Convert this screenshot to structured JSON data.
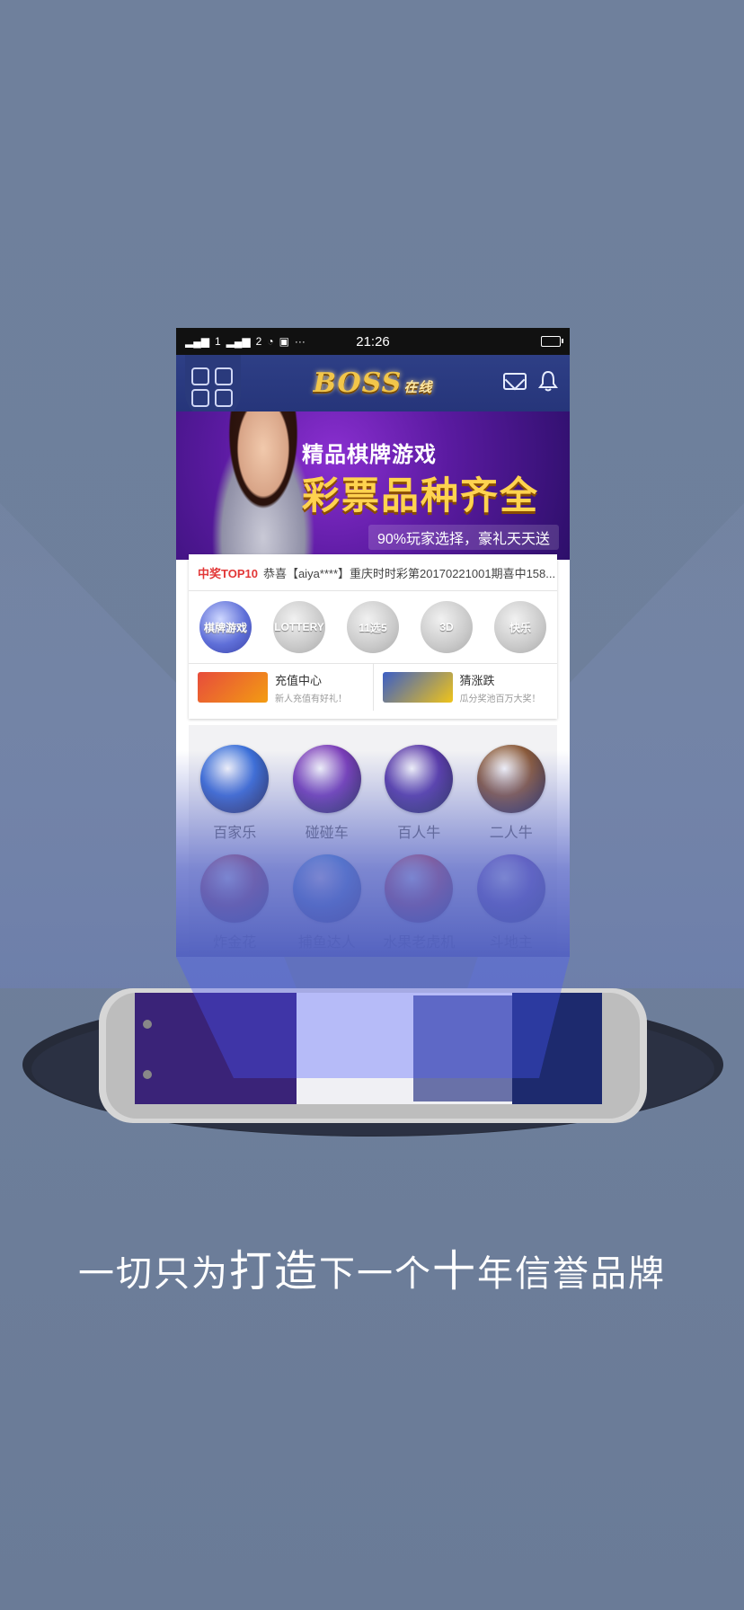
{
  "status_bar": {
    "time": "21:26",
    "carrier_1": "1",
    "carrier_2": "2",
    "extra": "···"
  },
  "app": {
    "logo_text": "BOSS",
    "logo_suffix": "在线"
  },
  "banner": {
    "line1": "精品棋牌游戏",
    "line2": "彩票品种齐全",
    "line3": "90%玩家选择，豪礼天天送"
  },
  "ticker": {
    "tag": "中奖TOP10",
    "text": "恭喜【aiya****】重庆时时彩第20170221001期喜中158..."
  },
  "lotteries": [
    "棋牌游戏",
    "LOTTERY",
    "11选5",
    "3D",
    "快乐"
  ],
  "quick_links": [
    {
      "title": "充值中心",
      "subtitle": "新人充值有好礼！"
    },
    {
      "title": "猜涨跌",
      "subtitle": "瓜分奖池百万大奖！"
    }
  ],
  "games": [
    {
      "name": "百家乐",
      "color": "#3b6fd8"
    },
    {
      "name": "碰碰车",
      "color": "#7a3db8"
    },
    {
      "name": "百人牛",
      "color": "#5a3aa8"
    },
    {
      "name": "二人牛",
      "color": "#8a5a3a"
    },
    {
      "name": "炸金花",
      "color": "#b23a4a"
    },
    {
      "name": "捕鱼达人",
      "color": "#3a8ad8"
    },
    {
      "name": "水果老虎机",
      "color": "#d83a3a"
    },
    {
      "name": "斗地主",
      "color": "#6a4ab8"
    }
  ],
  "slogan": {
    "part1": "一切只为",
    "part2": "打造",
    "part3": "下一个",
    "part4": "十",
    "part5": "年信誉品牌"
  },
  "colors": {
    "background": "#6f809c",
    "appbar": "#2e3f86",
    "beam": "#5562d6"
  }
}
